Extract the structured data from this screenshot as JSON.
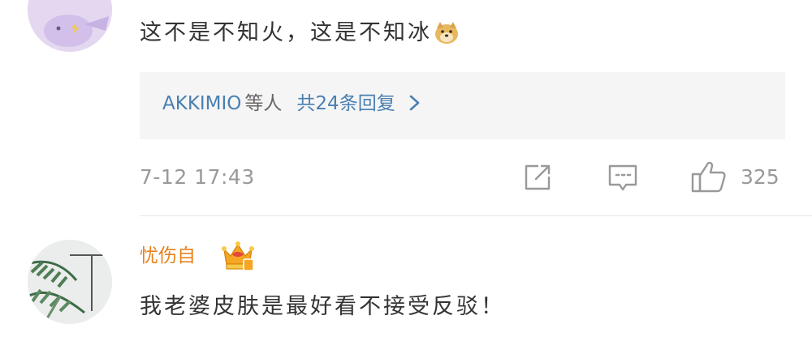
{
  "comment1": {
    "text": "这不是不知火，这是不知冰",
    "emoji": "doge-emoji",
    "replies": {
      "names": "AKKIMIO",
      "names_suffix": "等人",
      "count_text": "共24条回复"
    },
    "timestamp": "7-12 17:43",
    "like_count": "325"
  },
  "comment2": {
    "username": "忧伤自",
    "badge": "crown-badge",
    "text": "我老婆皮肤是最好看不接受反驳！"
  },
  "colors": {
    "username": "#e8811a",
    "link": "#4a7fb0",
    "meta": "#999999",
    "reply_bg": "#f5f5f5"
  }
}
